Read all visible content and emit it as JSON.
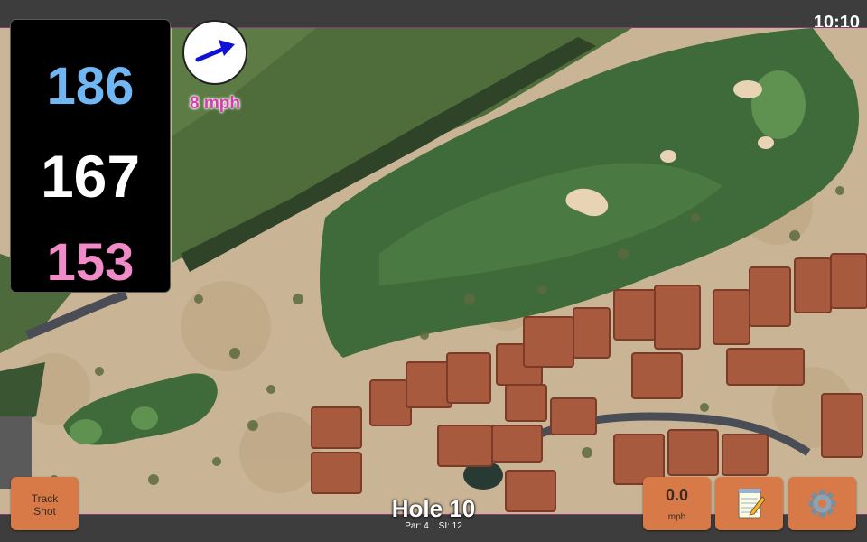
{
  "status_bar": {
    "time": "10:10"
  },
  "distances": {
    "back": "186",
    "middle": "167",
    "front": "153"
  },
  "wind": {
    "speed_label": "8 mph",
    "arrow_icon": "wind-direction-arrow-icon"
  },
  "buttons": {
    "track_shot": [
      "Track",
      "Shot"
    ],
    "wind_speed_value": "0.0",
    "wind_speed_unit": "mph",
    "notes_icon": "notepad-icon",
    "settings_icon": "gear-icon"
  },
  "hole": {
    "title": "Hole 10",
    "par": "Par: 4",
    "si": "SI: 12"
  },
  "colors": {
    "back_distance": "#6fb6f2",
    "middle_distance": "#ffffff",
    "front_distance": "#f08ac8",
    "button": "#d87a48",
    "wind_label": "#d23fa8"
  }
}
